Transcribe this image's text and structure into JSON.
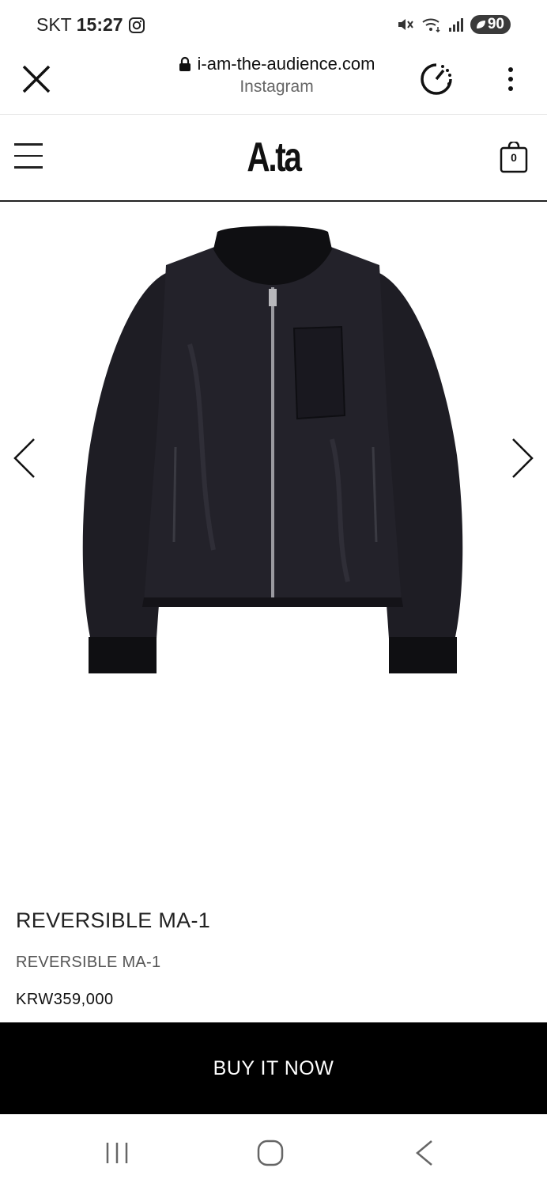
{
  "status_bar": {
    "carrier": "SKT",
    "time": "15:27",
    "battery": "90"
  },
  "browser": {
    "domain": "i-am-the-audience.com",
    "source": "Instagram"
  },
  "site": {
    "logo": "A.ta",
    "cart_count": "0"
  },
  "product": {
    "title": "REVERSIBLE MA-1",
    "subtitle": "REVERSIBLE MA-1",
    "price": "KRW359,000",
    "image_icon": "black-bomber-jacket"
  },
  "actions": {
    "buy_label": "BUY IT NOW"
  },
  "colors": {
    "accent": "#000000",
    "jacket": "#1b1a20"
  }
}
